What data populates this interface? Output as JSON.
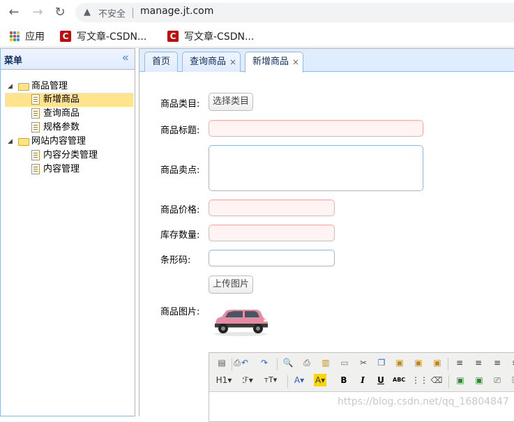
{
  "browser": {
    "insecure_label": "不安全",
    "url": "manage.jt.com"
  },
  "bookmarks": {
    "apps_label": "应用",
    "items": [
      "写文章-CSDN...",
      "写文章-CSDN..."
    ]
  },
  "sidebar": {
    "title": "菜单",
    "tree": [
      {
        "label": "商品管理",
        "type": "folder"
      },
      {
        "label": "新增商品",
        "type": "file",
        "selected": true
      },
      {
        "label": "查询商品",
        "type": "file"
      },
      {
        "label": "规格参数",
        "type": "file"
      },
      {
        "label": "网站内容管理",
        "type": "folder"
      },
      {
        "label": "内容分类管理",
        "type": "file"
      },
      {
        "label": "内容管理",
        "type": "file"
      }
    ]
  },
  "tabs": [
    {
      "label": "首页",
      "closable": false
    },
    {
      "label": "查询商品",
      "closable": true
    },
    {
      "label": "新增商品",
      "closable": true,
      "active": true
    }
  ],
  "tab_close_glyph": "×",
  "form": {
    "category_label": "商品类目:",
    "category_button": "选择类目",
    "title_label": "商品标题:",
    "title_value": "",
    "selling_point_label": "商品卖点:",
    "selling_point_value": "",
    "price_label": "商品价格:",
    "price_value": "",
    "stock_label": "库存数量:",
    "stock_value": "",
    "barcode_label": "条形码:",
    "barcode_value": "",
    "upload_button": "上传图片",
    "image_label": "商品图片:"
  },
  "editor": {
    "heading_button": "H1",
    "font_button": "ℱ",
    "size_button": "тT"
  },
  "watermark": "https://blog.csdn.net/qq_16804847",
  "colors": {
    "accent_border": "#95b8e7",
    "selected_row": "#ffe48d",
    "invalid_bg": "#fff3f3",
    "invalid_border": "#ffa8a8",
    "car": "#e88aa3"
  }
}
